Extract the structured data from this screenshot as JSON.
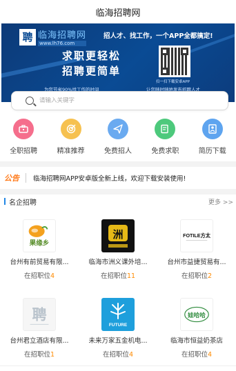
{
  "page": {
    "title": "临海招聘网"
  },
  "banner": {
    "logo_mark": "聘",
    "logo_name": "临海招聘网",
    "logo_url": "www.lh76.com",
    "headline_top": "招人才、找工作，一个APP全都搞定!",
    "headline_1": "求职更轻松",
    "headline_2": "招聘更简单",
    "sub_left": "为您节省90%找工作的时间",
    "sub_right": "让您随时随地发布招聘人才",
    "qr_label": "扫一扫下载安卓APP"
  },
  "search": {
    "placeholder": "请输入关键字"
  },
  "nav": {
    "items": [
      {
        "label": "全职招聘",
        "icon": "briefcase-icon",
        "color": "#f56e8c"
      },
      {
        "label": "精准推荐",
        "icon": "target-icon",
        "color": "#f6c150"
      },
      {
        "label": "免费招人",
        "icon": "paper-plane-icon",
        "color": "#6aaaf0"
      },
      {
        "label": "免费求职",
        "icon": "search-icon",
        "color": "#4dc97c"
      },
      {
        "label": "简历下载",
        "icon": "resume-icon",
        "color": "#5ea4ef"
      }
    ]
  },
  "notice": {
    "tag": "公告",
    "text": "临海招聘网APP安卓版全新上线，欢迎下载安装使用!"
  },
  "section": {
    "title": "名企招聘",
    "more": "更多 >>"
  },
  "companies": [
    {
      "name": "台州有前贸易有限...",
      "prefix": "在招职位",
      "count": "4",
      "logo_text": "果缘乡"
    },
    {
      "name": "临海市洲义课外培...",
      "prefix": "在招职位",
      "count": "11",
      "logo_text": "洲"
    },
    {
      "name": "台州市益捷贸易有...",
      "prefix": "在招职位",
      "count": "2",
      "logo_text": "FOTILE方太"
    },
    {
      "name": "台州君立酒店有限...",
      "prefix": "在招职位",
      "count": "1",
      "logo_text": "聘"
    },
    {
      "name": "未来万家五金机电...",
      "prefix": "在招职位",
      "count": "4",
      "logo_text": "FUTURE"
    },
    {
      "name": "临海市恒益奶茶店",
      "prefix": "在招职位",
      "count": "4",
      "logo_text": "娃哈哈"
    }
  ],
  "colors": {
    "accent": "#1f86e5",
    "count": "#ff8a00",
    "notice_tag": "#ff7a1a"
  }
}
